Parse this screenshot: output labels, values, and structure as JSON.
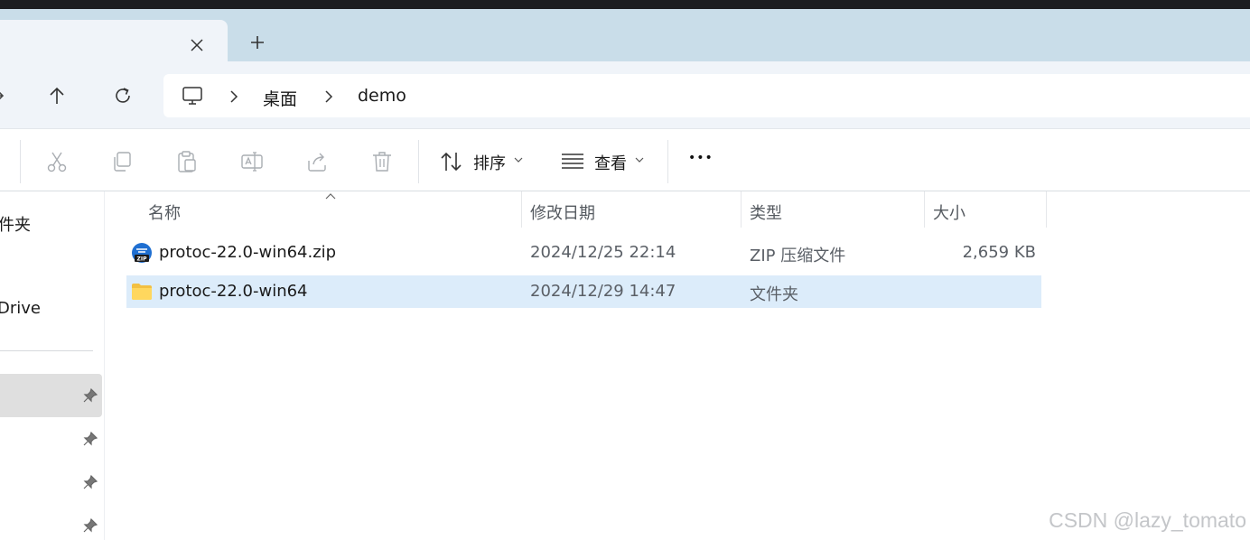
{
  "window": {
    "tab": {
      "close_glyph": "✕"
    },
    "new_tab_glyph": "+"
  },
  "navigation": {
    "breadcrumb": [
      {
        "label": "桌面"
      },
      {
        "label": "demo"
      }
    ]
  },
  "toolbar": {
    "actions": [
      {
        "name": "cut-icon"
      },
      {
        "name": "copy-icon"
      },
      {
        "name": "paste-icon"
      },
      {
        "name": "rename-icon"
      },
      {
        "name": "share-icon"
      },
      {
        "name": "delete-icon"
      }
    ],
    "sort_label": "排序",
    "view_label": "查看",
    "more_glyph": "•••"
  },
  "sidebar": {
    "items": [
      {
        "label": "件夹"
      },
      {
        "label": "Drive"
      }
    ],
    "pinned_count": 4
  },
  "file_list": {
    "columns": [
      "名称",
      "修改日期",
      "类型",
      "大小"
    ],
    "sort_column": "名称",
    "rows": [
      {
        "name": "protoc-22.0-win64.zip",
        "modified": "2024/12/25 22:14",
        "type": "ZIP 压缩文件",
        "size": "2,659 KB",
        "icon": "zip-file-icon",
        "selected": false
      },
      {
        "name": "protoc-22.0-win64",
        "modified": "2024/12/29 14:47",
        "type": "文件夹",
        "size": "",
        "icon": "folder-icon",
        "selected": true
      }
    ]
  },
  "watermark": "CSDN @lazy_tomato",
  "colors": {
    "accent": "#0067c0",
    "selection": "#dcecfa",
    "tabstrip": "#c9dde9"
  }
}
